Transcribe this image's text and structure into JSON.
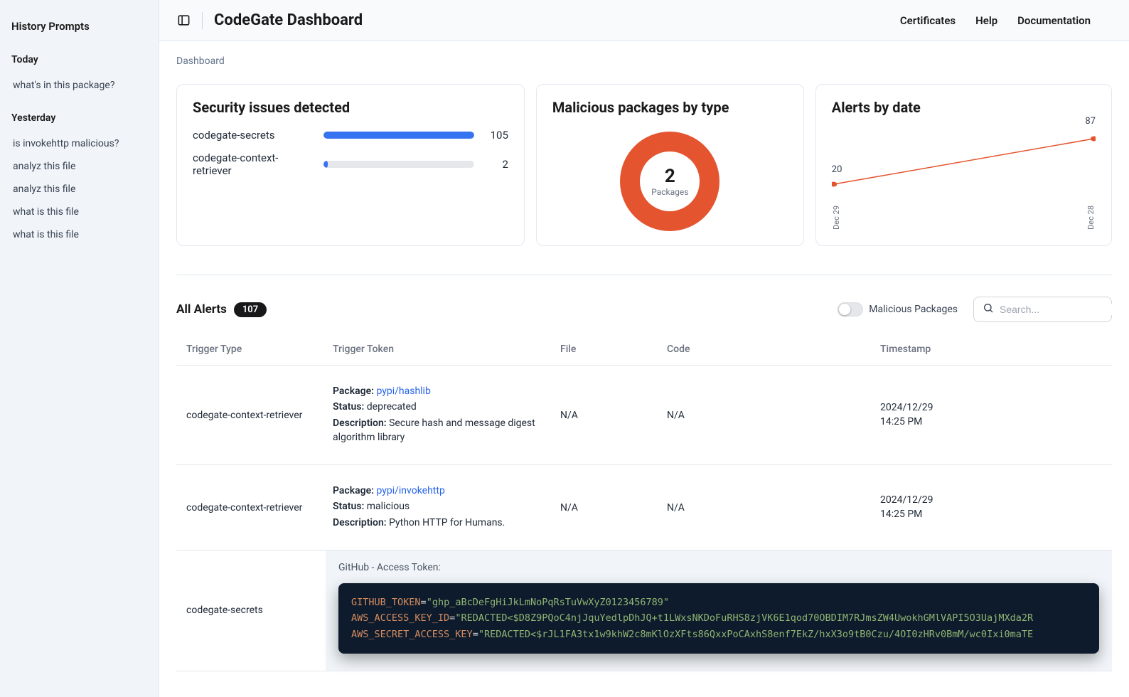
{
  "sidebar": {
    "title": "History Prompts",
    "groups": [
      {
        "label": "Today",
        "items": [
          "what's in this package?"
        ]
      },
      {
        "label": "Yesterday",
        "items": [
          "is invokehttp malicious?",
          "analyz this file",
          "analyz this file",
          "what is this file",
          "what is this file"
        ]
      }
    ]
  },
  "header": {
    "title": "CodeGate Dashboard",
    "nav": [
      "Certificates",
      "Help",
      "Documentation"
    ]
  },
  "breadcrumb": "Dashboard",
  "cards": {
    "security": {
      "title": "Security issues detected",
      "rows": [
        {
          "label": "codegate-secrets",
          "value": 105,
          "max": 105
        },
        {
          "label": "codegate-context-retriever",
          "value": 2,
          "max": 105
        }
      ]
    },
    "malicious": {
      "title": "Malicious packages by type",
      "count": "2",
      "label": "Packages"
    },
    "alertsByDate": {
      "title": "Alerts by date",
      "v0": "20",
      "v1": "87",
      "t0": "Dec 29",
      "t1": "Dec 28"
    }
  },
  "chart_data": [
    {
      "type": "bar",
      "title": "Security issues detected",
      "categories": [
        "codegate-secrets",
        "codegate-context-retriever"
      ],
      "values": [
        105,
        2
      ],
      "xlabel": "",
      "ylabel": "",
      "xlim": [
        0,
        105
      ]
    },
    {
      "type": "pie",
      "title": "Malicious packages by type",
      "categories": [
        "Packages"
      ],
      "values": [
        2
      ]
    },
    {
      "type": "line",
      "title": "Alerts by date",
      "categories": [
        "Dec 29",
        "Dec 28"
      ],
      "values": [
        20,
        87
      ],
      "xlabel": "",
      "ylabel": "",
      "ylim": [
        0,
        100
      ]
    }
  ],
  "alerts": {
    "title": "All Alerts",
    "count": "107",
    "toggleLabel": "Malicious Packages",
    "searchPlaceholder": "Search...",
    "columns": [
      "Trigger Type",
      "Trigger Token",
      "File",
      "Code",
      "Timestamp"
    ],
    "rows": [
      {
        "trigger": "codegate-context-retriever",
        "pkgLabel": "Package:",
        "pkg": "pypi/hashlib",
        "statusLabel": "Status:",
        "status": "deprecated",
        "descLabel": "Description:",
        "desc": "Secure hash and message digest algorithm library",
        "file": "N/A",
        "code": "N/A",
        "ts1": "2024/12/29",
        "ts2": "14:25 PM"
      },
      {
        "trigger": "codegate-context-retriever",
        "pkgLabel": "Package:",
        "pkg": "pypi/invokehttp",
        "statusLabel": "Status:",
        "status": "malicious",
        "descLabel": "Description:",
        "desc": "Python HTTP for Humans.",
        "file": "N/A",
        "code": "N/A",
        "ts1": "2024/12/29",
        "ts2": "14:25 PM"
      }
    ],
    "secretsRow": {
      "trigger": "codegate-secrets",
      "codeTitle": "GitHub - Access Token:",
      "lines": [
        {
          "k": "GITHUB_TOKEN",
          "v": "\"ghp_aBcDeFgHiJkLmNoPqRsTuVwXyZ0123456789\""
        },
        {
          "k": "AWS_ACCESS_KEY_ID",
          "v": "\"REDACTED<$D8Z9PQoC4njJquYedlpDhJQ+t1LWxsNKDoFuRHS8zjVK6E1qod70OBDIM7RJmsZW4UwokhGMlVAPI5O3UajMXda2R"
        },
        {
          "k": "AWS_SECRET_ACCESS_KEY",
          "v": "\"REDACTED<$rJL1FA3tx1w9khW2c8mKlOzXFts86QxxPoCAxhS8enf7EkZ/hxX3o9tB0Czu/4OI0zHRv0BmM/wc0Ixi0maTE"
        }
      ]
    }
  }
}
